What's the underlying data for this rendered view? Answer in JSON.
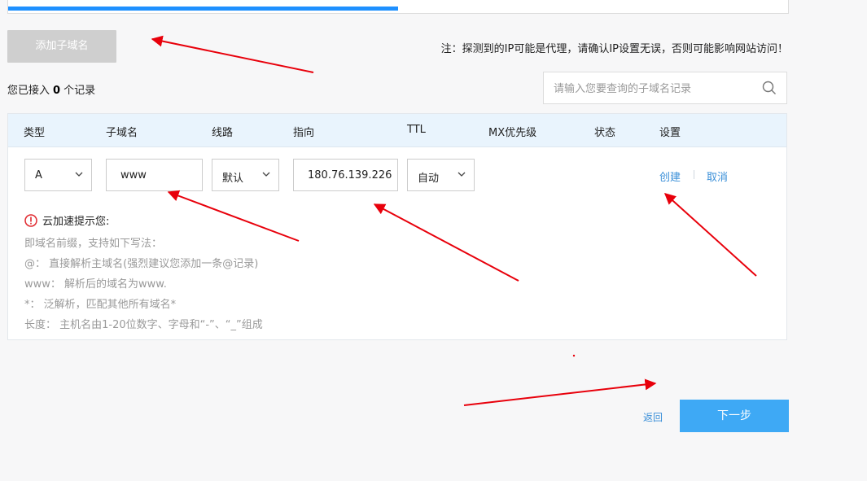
{
  "progress": {
    "fraction": 0.5
  },
  "toolbar": {
    "add_subdomain_label": "添加子域名"
  },
  "notice": "注：探测到的IP可能是代理，请确认IP设置无误，否则可能影响网站访问！",
  "summary": {
    "prefix": "您已接入",
    "count": "0",
    "suffix": "个记录"
  },
  "search": {
    "placeholder": "请输入您要查询的子域名记录",
    "icon": "search-icon"
  },
  "table": {
    "headers": [
      "类型",
      "子域名",
      "线路",
      "指向",
      "TTL",
      "MX优先级",
      "状态",
      "设置"
    ],
    "row": {
      "type": "A",
      "subdomain": "www",
      "line": "默认",
      "target": "180.76.139.226",
      "ttl": "自动",
      "actions": {
        "create": "创建",
        "cancel": "取消"
      }
    },
    "tip": {
      "title": "云加速提示您:",
      "lines": [
        "即域名前缀，支持如下写法：",
        "@：  直接解析主域名(强烈建议您添加一条@记录)",
        "www：  解析后的域名为www.",
        "*：  泛解析，匹配其他所有域名*",
        "长度：  主机名由1-20位数字、字母和“-”、“_”组成"
      ]
    }
  },
  "footer": {
    "back_label": "返回",
    "next_label": "下一步"
  },
  "colors": {
    "accent": "#3ea9f5",
    "progress": "#1e90ff",
    "annotation": "#e8000b",
    "link": "#3a8fd8"
  }
}
